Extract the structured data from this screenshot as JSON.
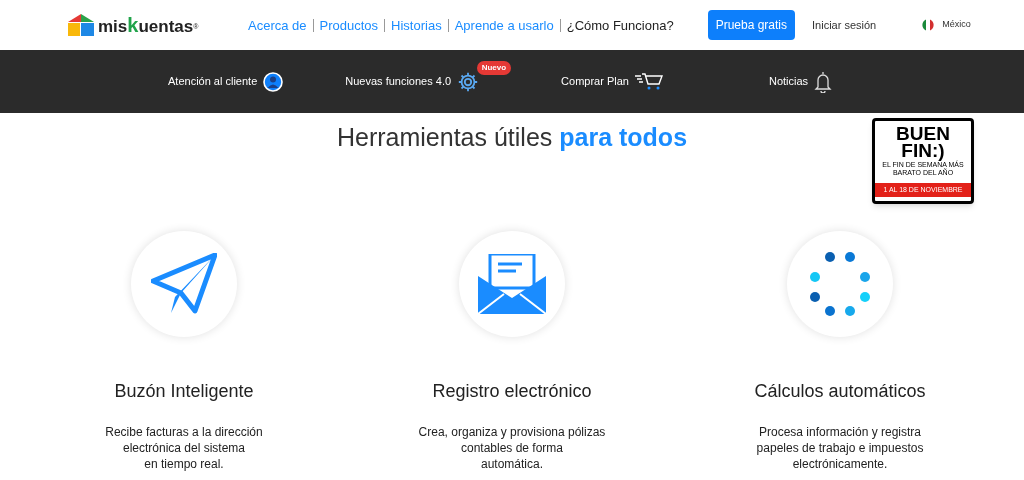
{
  "logo": {
    "prefix": "mis",
    "accent": "k",
    "rest": "uentas",
    "mark": "®"
  },
  "nav": [
    {
      "label": "Acerca de",
      "selected": false
    },
    {
      "label": "Productos",
      "selected": false
    },
    {
      "label": "Historias",
      "selected": false
    },
    {
      "label": "Aprende a usarlo",
      "selected": false
    },
    {
      "label": "¿Cómo Funciona?",
      "selected": true
    }
  ],
  "cta": "Prueba gratis",
  "login": "Iniciar sesión",
  "country": "México",
  "subnav": [
    {
      "label": "Atención al cliente",
      "kind": "user"
    },
    {
      "label": "Nuevas funciones 4.0",
      "kind": "gear",
      "badge": "Nuevo"
    },
    {
      "label": "Comprar Plan",
      "kind": "cart"
    },
    {
      "label": "Noticias",
      "kind": "bell"
    }
  ],
  "heading": {
    "plain": "Herramientas útiles",
    "accent": "para todos"
  },
  "promo": {
    "line1": "BUEN",
    "line2": "FIN:)",
    "tagline": "EL FIN DE SEMANA MÁS BARATO DEL AÑO",
    "dates": "1 AL 18 DE NOVIEMBRE"
  },
  "features": [
    {
      "kind": "plane",
      "title": "Buzón Inteligente",
      "lines": [
        "Recibe facturas a la dirección",
        "electrónica del sistema",
        "en tiempo real."
      ]
    },
    {
      "kind": "mail",
      "title": "Registro electrónico",
      "lines": [
        "Crea, organiza y provisiona pólizas",
        "contables de forma",
        "automática."
      ]
    },
    {
      "kind": "dots",
      "title": "Cálculos automáticos",
      "lines": [
        "Procesa información y registra",
        "papeles de trabajo e impuestos",
        "electrónicamente."
      ]
    }
  ]
}
